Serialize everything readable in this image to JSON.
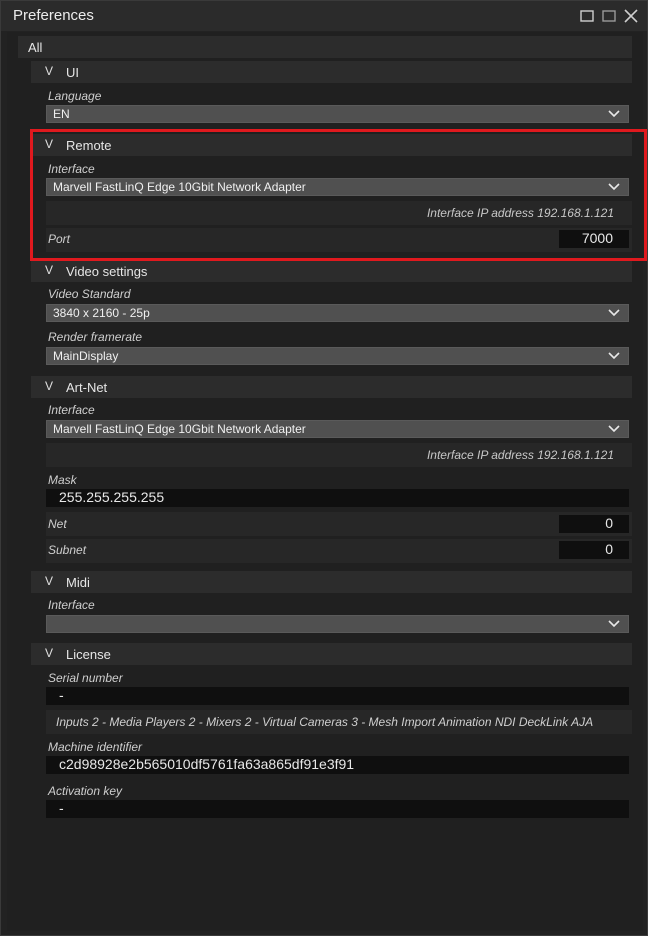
{
  "window": {
    "title": "Preferences"
  },
  "tree": {
    "root": "All"
  },
  "ui": {
    "title": "UI",
    "language_label": "Language",
    "language_value": "EN"
  },
  "remote": {
    "title": "Remote",
    "interface_label": "Interface",
    "interface_value": "Marvell FastLinQ Edge 10Gbit Network Adapter",
    "ip_info": "Interface IP address 192.168.1.121",
    "port_label": "Port",
    "port_value": "7000"
  },
  "video": {
    "title": "Video settings",
    "standard_label": "Video Standard",
    "standard_value": "3840 x 2160 - 25p",
    "framerate_label": "Render framerate",
    "framerate_value": "MainDisplay"
  },
  "artnet": {
    "title": "Art-Net",
    "interface_label": "Interface",
    "interface_value": "Marvell FastLinQ Edge 10Gbit Network Adapter",
    "ip_info": "Interface IP address 192.168.1.121",
    "mask_label": "Mask",
    "mask_value": "255.255.255.255",
    "net_label": "Net",
    "net_value": "0",
    "subnet_label": "Subnet",
    "subnet_value": "0"
  },
  "midi": {
    "title": "Midi",
    "interface_label": "Interface",
    "interface_value": ""
  },
  "license": {
    "title": "License",
    "serial_label": "Serial number",
    "serial_value": "-",
    "features": "Inputs 2 - Media Players 2 - Mixers 2 - Virtual Cameras 3 - Mesh Import Animation NDI DeckLink AJA",
    "machine_label": "Machine identifier",
    "machine_value": "c2d98928e2b565010df5761fa63a865df91e3f91",
    "activation_label": "Activation key",
    "activation_value": "-"
  },
  "colors": {
    "highlight": "#e0191e",
    "panel": "#202020",
    "dropdown": "#505050",
    "field": "#0f0f0f"
  },
  "icons": {
    "minimize": "minimize-icon",
    "maximize": "maximize-icon",
    "close": "close-icon",
    "expand": "chevron-down-icon",
    "dropdown": "dropdown-arrow-icon"
  }
}
